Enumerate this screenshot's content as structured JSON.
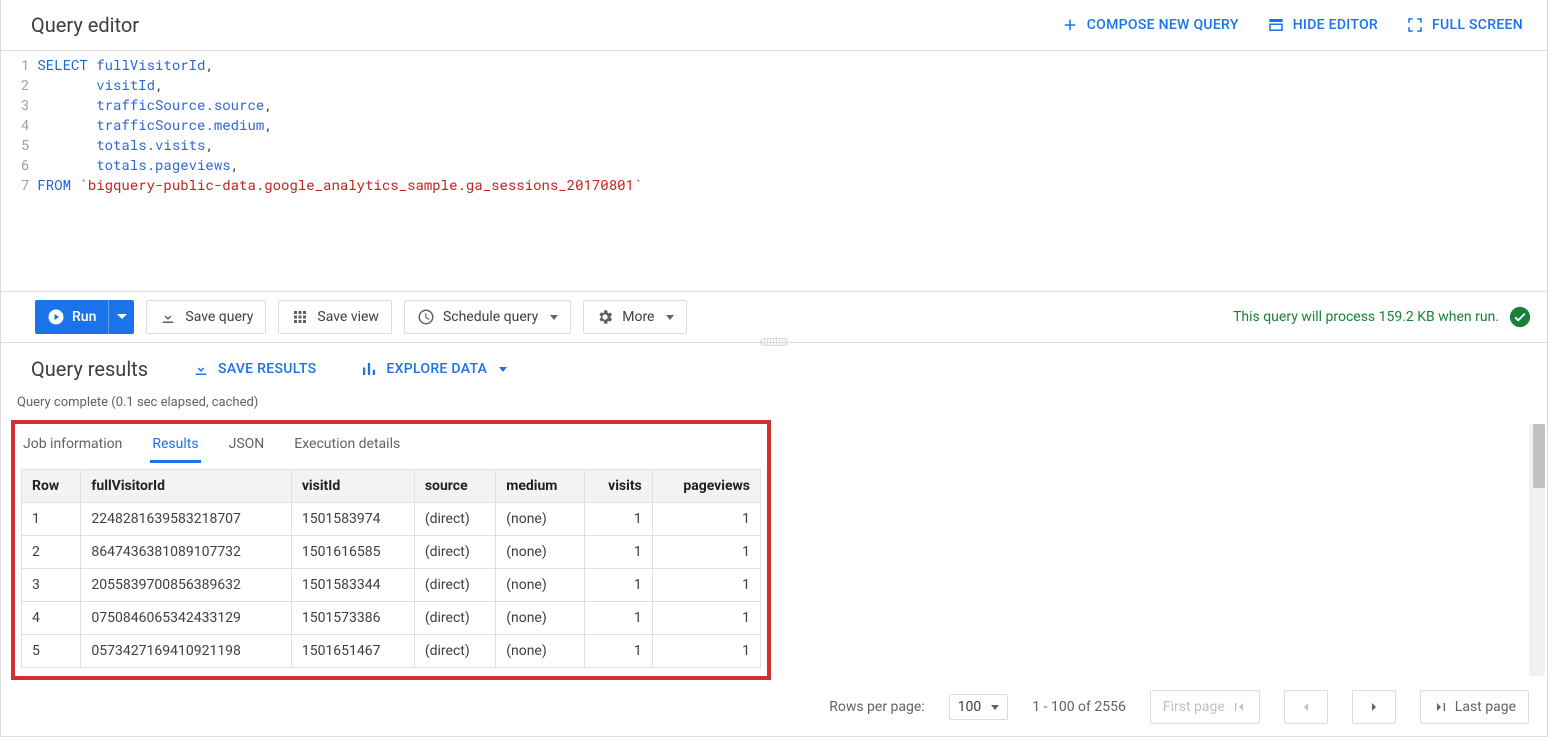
{
  "header": {
    "title": "Query editor",
    "compose": "COMPOSE NEW QUERY",
    "hide": "HIDE EDITOR",
    "full": "FULL SCREEN"
  },
  "code_lines": [
    [
      [
        "kw",
        "SELECT"
      ],
      [
        "",
        " "
      ],
      [
        "id",
        "fullVisitorId"
      ],
      [
        "",
        ","
      ]
    ],
    [
      [
        "",
        "       "
      ],
      [
        "id",
        "visitId"
      ],
      [
        "",
        ","
      ]
    ],
    [
      [
        "",
        "       "
      ],
      [
        "id",
        "trafficSource.source"
      ],
      [
        "",
        ","
      ]
    ],
    [
      [
        "",
        "       "
      ],
      [
        "id",
        "trafficSource.medium"
      ],
      [
        "",
        ","
      ]
    ],
    [
      [
        "",
        "       "
      ],
      [
        "id",
        "totals.visits"
      ],
      [
        "",
        ","
      ]
    ],
    [
      [
        "",
        "       "
      ],
      [
        "id",
        "totals.pageviews"
      ],
      [
        "",
        ","
      ]
    ],
    [
      [
        "kw",
        "FROM"
      ],
      [
        "",
        " "
      ],
      [
        "str",
        "`bigquery-public-data.google_analytics_sample.ga_sessions_20170801`"
      ]
    ]
  ],
  "toolbar": {
    "run": "Run",
    "save_query": "Save query",
    "save_view": "Save view",
    "schedule": "Schedule query",
    "more": "More",
    "status": "This query will process 159.2 KB when run."
  },
  "results": {
    "title": "Query results",
    "save_results": "SAVE RESULTS",
    "explore": "EXPLORE DATA",
    "complete": "Query complete (0.1 sec elapsed, cached)",
    "tabs": {
      "job": "Job information",
      "results": "Results",
      "json": "JSON",
      "exec": "Execution details"
    },
    "columns": [
      "Row",
      "fullVisitorId",
      "visitId",
      "source",
      "medium",
      "visits",
      "pageviews"
    ],
    "rows": [
      {
        "row": "1",
        "fullVisitorId": "2248281639583218707",
        "visitId": "1501583974",
        "source": "(direct)",
        "medium": "(none)",
        "visits": "1",
        "pageviews": "1"
      },
      {
        "row": "2",
        "fullVisitorId": "8647436381089107732",
        "visitId": "1501616585",
        "source": "(direct)",
        "medium": "(none)",
        "visits": "1",
        "pageviews": "1"
      },
      {
        "row": "3",
        "fullVisitorId": "2055839700856389632",
        "visitId": "1501583344",
        "source": "(direct)",
        "medium": "(none)",
        "visits": "1",
        "pageviews": "1"
      },
      {
        "row": "4",
        "fullVisitorId": "0750846065342433129",
        "visitId": "1501573386",
        "source": "(direct)",
        "medium": "(none)",
        "visits": "1",
        "pageviews": "1"
      },
      {
        "row": "5",
        "fullVisitorId": "0573427169410921198",
        "visitId": "1501651467",
        "source": "(direct)",
        "medium": "(none)",
        "visits": "1",
        "pageviews": "1"
      }
    ]
  },
  "pager": {
    "label": "Rows per page:",
    "page_size": "100",
    "range": "1 - 100 of 2556",
    "first": "First page",
    "last": "Last page"
  }
}
